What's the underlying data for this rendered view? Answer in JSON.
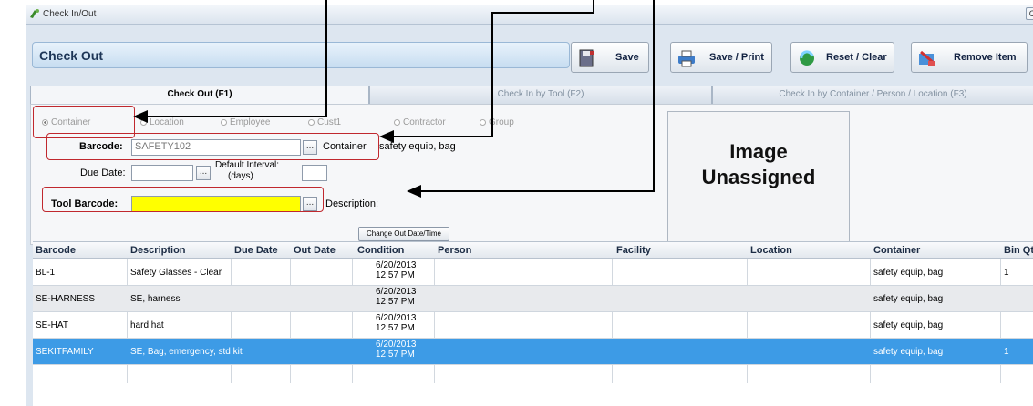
{
  "window": {
    "title": "Check In/Out",
    "corner_btn": "C"
  },
  "header": {
    "title": "Check Out"
  },
  "toolbar": {
    "save": "Save",
    "save_print": "Save / Print",
    "reset": "Reset / Clear",
    "remove": "Remove Item"
  },
  "tabs": [
    {
      "label": "Check Out (F1)",
      "active": true
    },
    {
      "label": "Check In by Tool (F2)",
      "active": false
    },
    {
      "label": "Check In by Container / Person / Location (F3)",
      "active": false
    }
  ],
  "radios": [
    {
      "label": "Container",
      "checked": true
    },
    {
      "label": "Location",
      "checked": false
    },
    {
      "label": "Employee",
      "checked": false
    },
    {
      "label": "Cust1",
      "checked": false
    },
    {
      "label": "Contractor",
      "checked": false
    },
    {
      "label": "Group",
      "checked": false
    }
  ],
  "form": {
    "barcode_label": "Barcode:",
    "barcode_value": "SAFETY102",
    "container_label": "Container",
    "container_value": "safety equip, bag",
    "due_date_label": "Due Date:",
    "due_date_value": "",
    "interval_label_1": "Default Interval:",
    "interval_label_2": "(days)",
    "interval_value": "",
    "tool_barcode_label": "Tool Barcode:",
    "tool_barcode_value": "",
    "description_label": "Description:",
    "change_btn": "Change Out Date/Time",
    "ellipsis": "..."
  },
  "image": {
    "line1": "Image",
    "line2": "Unassigned"
  },
  "grid": {
    "columns": [
      "Barcode",
      "Description",
      "Due Date",
      "Out Date",
      "Condition",
      "Person",
      "Facility",
      "Location",
      "Container",
      "Bin Qty"
    ],
    "rows": [
      {
        "barcode": "BL-1",
        "description": "Safety Glasses - Clear",
        "due": "",
        "out1": "6/20/2013",
        "out2": "12:57 PM",
        "container": "safety equip, bag",
        "qty": "1",
        "style": "normal"
      },
      {
        "barcode": "SE-HARNESS",
        "description": "SE, harness",
        "due": "",
        "out1": "6/20/2013",
        "out2": "12:57 PM",
        "container": "safety equip, bag",
        "qty": "",
        "style": "alt"
      },
      {
        "barcode": "SE-HAT",
        "description": "hard hat",
        "due": "",
        "out1": "6/20/2013",
        "out2": "12:57 PM",
        "container": "safety equip, bag",
        "qty": "",
        "style": "normal"
      },
      {
        "barcode": "SEKITFAMILY",
        "description": "SE, Bag, emergency, std kit",
        "due": "",
        "out1": "6/20/2013",
        "out2": "12:57 PM",
        "container": "safety equip, bag",
        "qty": "1",
        "style": "sel"
      }
    ]
  },
  "colors": {
    "annotation": "#c0282e",
    "selection": "#3d9be6",
    "tool_barcode_bg": "#ffff00"
  }
}
